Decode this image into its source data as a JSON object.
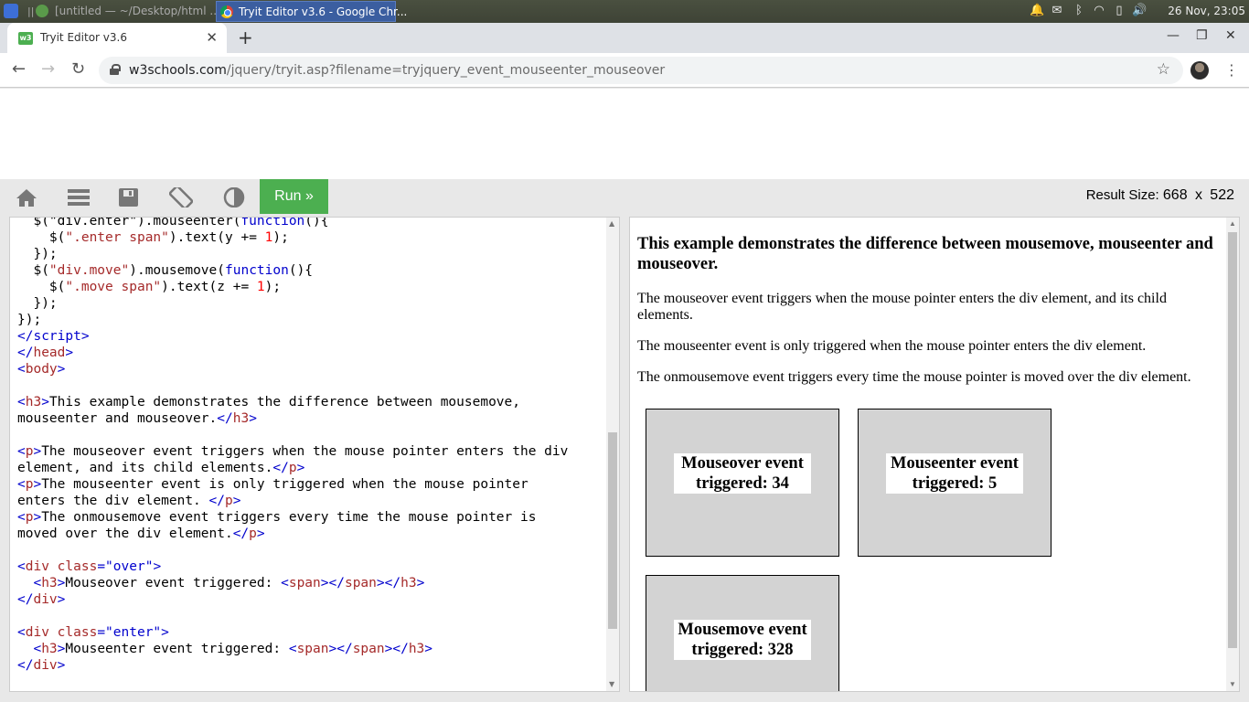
{
  "taskbar": {
    "app1_title": "[untitled — ~/Desktop/html ...",
    "app2_title": "Tryit Editor v3.6 - Google Chr...",
    "clock": "26 Nov, 23:05"
  },
  "browser": {
    "tab_title": "Tryit Editor v3.6",
    "url_host": "w3schools.com",
    "url_path": "/jquery/tryit.asp?filename=tryjquery_event_mouseenter_mouseover"
  },
  "editor": {
    "run_label": "Run »",
    "result_size_label": "Result Size:",
    "result_width": "668",
    "result_x": "x",
    "result_height": "522"
  },
  "result": {
    "heading": "This example demonstrates the difference between mousemove, mouseenter and mouseover.",
    "p1": "The mouseover event triggers when the mouse pointer enters the div element, and its child elements.",
    "p2": "The mouseenter event is only triggered when the mouse pointer enters the div element.",
    "p3": "The onmousemove event triggers every time the mouse pointer is moved over the div element.",
    "over_label": "Mouseover event triggered: 34",
    "enter_label": "Mouseenter event triggered: 5",
    "move_label": "Mousemove event triggered: 328"
  },
  "code": {
    "l1a": "  $(\"div.enter\").mouseenter(",
    "l1b": "function",
    "l1c": "(){",
    "l2a": "    $(",
    "l2b": "\".enter span\"",
    "l2c": ").text(y += ",
    "l2d": "1",
    "l2e": ");",
    "l3": "  });",
    "l4a": "  $(",
    "l4b": "\"div.move\"",
    "l4c": ").mousemove(",
    "l4d": "function",
    "l4e": "(){",
    "l5a": "    $(",
    "l5b": "\".move span\"",
    "l5c": ").text(z += ",
    "l5d": "1",
    "l5e": ");",
    "l6": "  });",
    "l7": "});",
    "l8a": "</",
    "l8b": "script",
    "l8c": ">",
    "l9a": "</",
    "l9b": "head",
    "l9c": ">",
    "l10a": "<",
    "l10b": "body",
    "l10c": ">",
    "l12a": "<",
    "l12b": "h3",
    "l12c": ">",
    "l12d": "This example demonstrates the difference between mousemove,",
    "l13a": "mouseenter and mouseover.",
    "l13b": "</",
    "l13c": "h3",
    "l13d": ">",
    "l15a": "<",
    "l15b": "p",
    "l15c": ">",
    "l15d": "The mouseover event triggers when the mouse pointer enters the div",
    "l16a": "element, and its child elements.",
    "l16b": "</",
    "l16c": "p",
    "l16d": ">",
    "l17a": "<",
    "l17b": "p",
    "l17c": ">",
    "l17d": "The mouseenter event is only triggered when the mouse pointer",
    "l18a": "enters the div element. ",
    "l18b": "</",
    "l18c": "p",
    "l18d": ">",
    "l19a": "<",
    "l19b": "p",
    "l19c": ">",
    "l19d": "The onmousemove event triggers every time the mouse pointer is",
    "l20a": "moved over the div element.",
    "l20b": "</",
    "l20c": "p",
    "l20d": ">",
    "l22a": "<",
    "l22b": "div",
    "l22c": " class",
    "l22d": "=\"over\"",
    "l22e": ">",
    "l23a": "  <",
    "l23b": "h3",
    "l23c": ">",
    "l23d": "Mouseover event triggered: ",
    "l23e": "<",
    "l23f": "span",
    "l23g": "></",
    "l23h": "span",
    "l23i": "></",
    "l23j": "h3",
    "l23k": ">",
    "l24a": "</",
    "l24b": "div",
    "l24c": ">",
    "l26a": "<",
    "l26b": "div",
    "l26c": " class",
    "l26d": "=\"enter\"",
    "l26e": ">",
    "l27a": "  <",
    "l27b": "h3",
    "l27c": ">",
    "l27d": "Mouseenter event triggered: ",
    "l27e": "<",
    "l27f": "span",
    "l27g": "></",
    "l27h": "span",
    "l27i": "></",
    "l27j": "h3",
    "l27k": ">",
    "l28a": "</",
    "l28b": "div",
    "l28c": ">"
  }
}
